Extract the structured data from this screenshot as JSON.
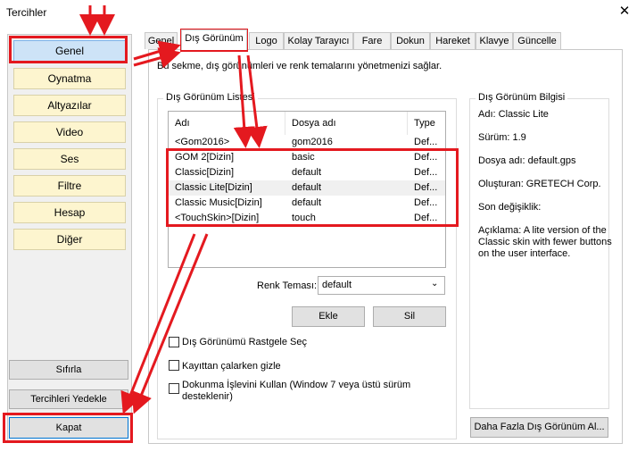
{
  "window": {
    "title": "Tercihler",
    "close_glyph": "✕"
  },
  "sidebar": {
    "categories": [
      "Genel",
      "Oynatma",
      "Altyazılar",
      "Video",
      "Ses",
      "Filtre",
      "Hesap",
      "Diğer"
    ],
    "selected": "Genel",
    "reset_label": "Sıfırla",
    "backup_label": "Tercihleri Yedekle",
    "close_label": "Kapat"
  },
  "tabs": [
    "Genel",
    "Dış Görünüm",
    "Logo",
    "Kolay Tarayıcı",
    "Fare",
    "Dokun",
    "Hareket",
    "Klavye",
    "Güncelle"
  ],
  "active_tab": "Dış Görünüm",
  "description": "Bu sekme, dış görünümleri ve renk temalarını yönetmenizi sağlar.",
  "skin_list": {
    "legend": "Dış Görünüm Listesi",
    "columns": [
      "Adı",
      "Dosya adı",
      "Type"
    ],
    "rows": [
      [
        "<Gom2016>",
        "gom2016",
        "Def..."
      ],
      [
        "GOM 2[Dizin]",
        "basic",
        "Def..."
      ],
      [
        "Classic[Dizin]",
        "default",
        "Def..."
      ],
      [
        "Classic Lite[Dizin]",
        "default",
        "Def..."
      ],
      [
        "Classic Music[Dizin]",
        "default",
        "Def..."
      ],
      [
        "<TouchSkin>[Dizin]",
        "touch",
        "Def..."
      ]
    ],
    "highlighted_row": 3
  },
  "color_theme": {
    "label": "Renk Teması:",
    "value": "default"
  },
  "add_label": "Ekle",
  "delete_label": "Sil",
  "options": [
    {
      "label": "Dış Görünümü Rastgele Seç",
      "checked": false
    },
    {
      "label": "Kayıttan çalarken gizle",
      "checked": false
    },
    {
      "label": "Dokunma İşlevini Kullan (Window 7 veya üstü sürüm",
      "label2": "desteklenir)",
      "checked": false
    }
  ],
  "info": {
    "legend": "Dış Görünüm Bilgisi",
    "name": "Adı: Classic Lite",
    "version": "Sürüm: 1.9",
    "file": "Dosya adı: default.gps",
    "author": "Oluşturan: GRETECH Corp.",
    "modified": "Son değişiklik:",
    "desc_lines": [
      "Açıklama: A lite version of the",
      "Classic skin with fewer buttons",
      "on the user interface."
    ]
  },
  "more_skins_label": "Daha Fazla Dış Görünüm Al...",
  "annotation_color": "#e4191f"
}
